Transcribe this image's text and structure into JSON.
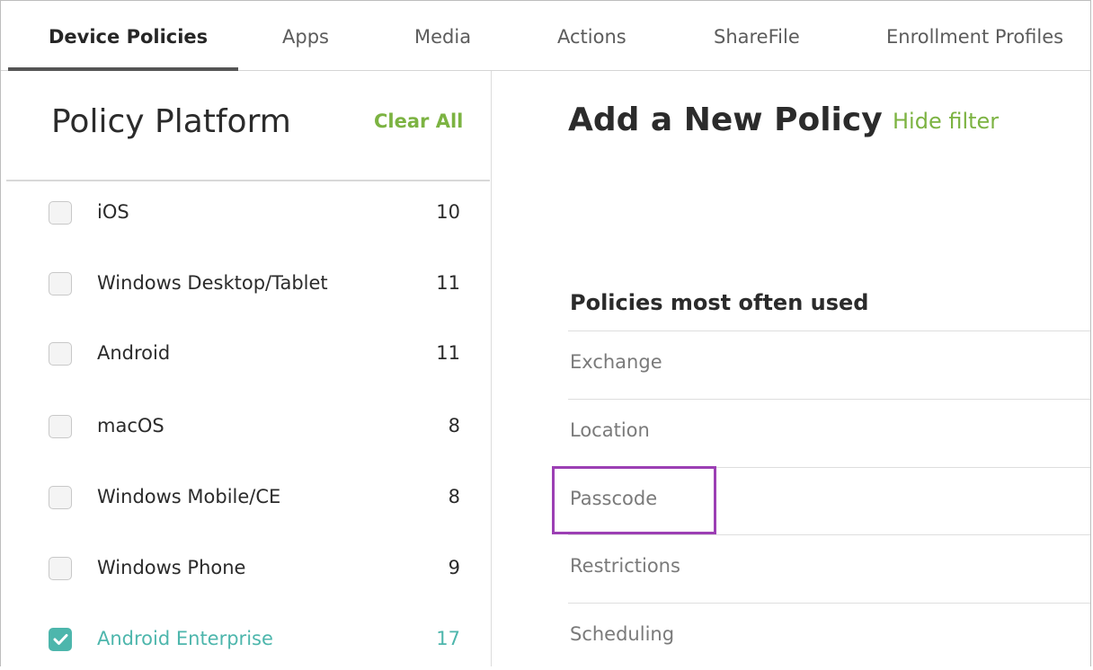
{
  "tabs": [
    {
      "label": "Device Policies",
      "active": true
    },
    {
      "label": "Apps",
      "active": false
    },
    {
      "label": "Media",
      "active": false
    },
    {
      "label": "Actions",
      "active": false
    },
    {
      "label": "ShareFile",
      "active": false
    },
    {
      "label": "Enrollment Profiles",
      "active": false
    }
  ],
  "filter_panel": {
    "title": "Policy Platform",
    "clear_all_label": "Clear All",
    "platforms": [
      {
        "label": "iOS",
        "count": "10",
        "checked": false
      },
      {
        "label": "Windows Desktop/Tablet",
        "count": "11",
        "checked": false
      },
      {
        "label": "Android",
        "count": "11",
        "checked": false
      },
      {
        "label": "macOS",
        "count": "8",
        "checked": false
      },
      {
        "label": "Windows Mobile/CE",
        "count": "8",
        "checked": false
      },
      {
        "label": "Windows Phone",
        "count": "9",
        "checked": false
      },
      {
        "label": "Android Enterprise",
        "count": "17",
        "checked": true
      }
    ]
  },
  "main": {
    "title": "Add a New Policy",
    "hide_filter_label": "Hide filter",
    "section_heading": "Policies most often used",
    "policies": [
      {
        "label": "Exchange"
      },
      {
        "label": "Location"
      },
      {
        "label": "Passcode",
        "highlighted": true
      },
      {
        "label": "Restrictions"
      },
      {
        "label": "Scheduling"
      }
    ]
  },
  "colors": {
    "accent_green": "#7cb342",
    "checked_teal": "#4db6ac",
    "highlight_purple": "#9c3fb4"
  }
}
